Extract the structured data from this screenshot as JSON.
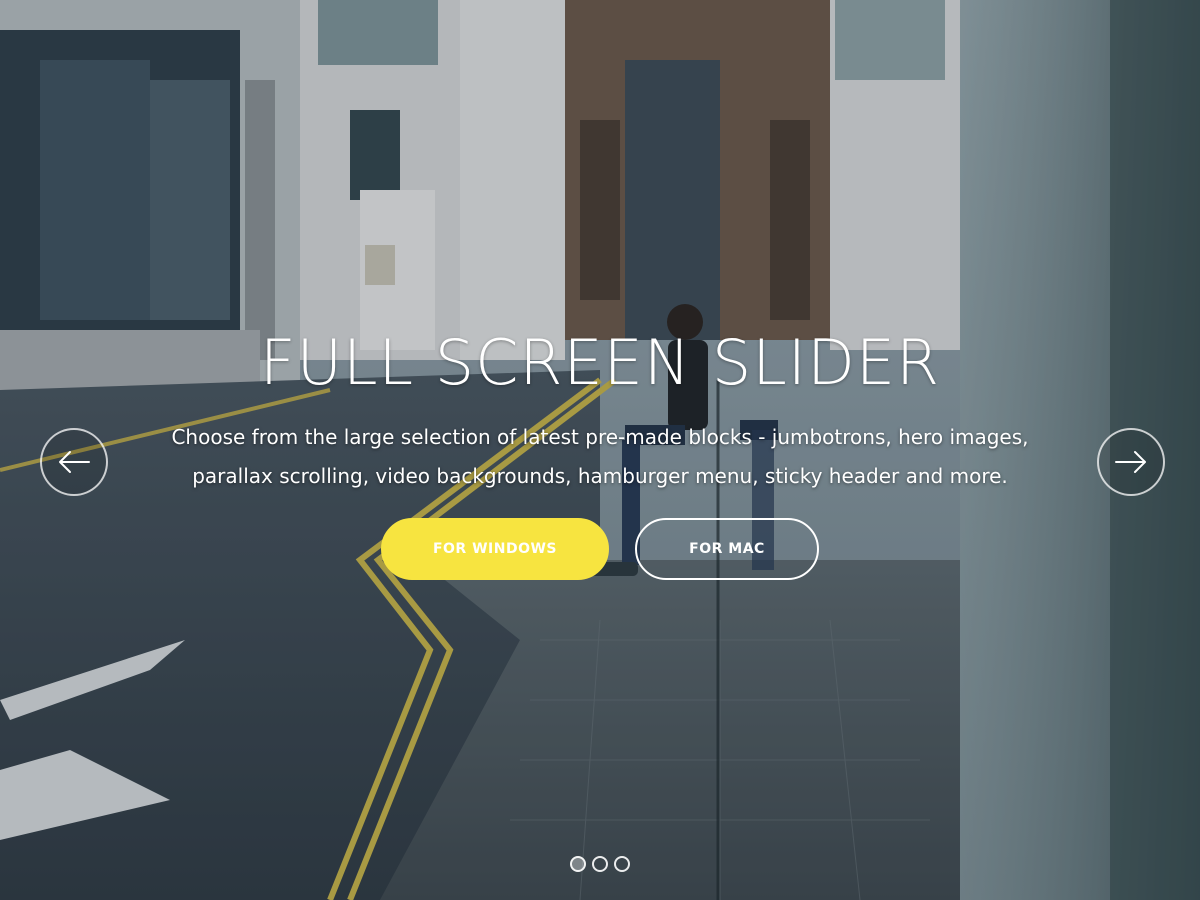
{
  "hero": {
    "title": "FULL SCREEN SLIDER",
    "subtitle_line1": "Choose from the large selection of latest pre-made blocks - jumbotrons, hero images,",
    "subtitle_line2": "parallax scrolling, video backgrounds, hamburger menu, sticky header and more.",
    "buttons": {
      "primary_label": "FOR WINDOWS",
      "secondary_label": "FOR MAC"
    }
  },
  "navigation": {
    "prev_icon": "arrow-left-icon",
    "next_icon": "arrow-right-icon"
  },
  "pagination": {
    "slide_count": 3,
    "active_index": 0
  },
  "colors": {
    "accent": "#f7e440",
    "text": "#ffffff"
  },
  "background": {
    "icon": "street-photo-background"
  }
}
